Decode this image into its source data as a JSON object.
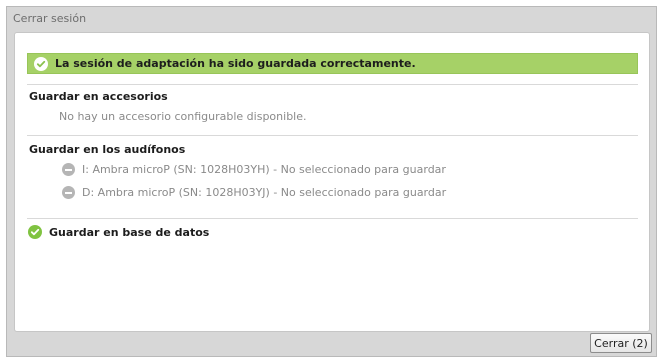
{
  "dialog": {
    "title": "Cerrar sesión",
    "banner": {
      "icon": "check-circle-icon",
      "text": "La sesión de adaptación ha sido guardada correctamente.",
      "color": "#a6d167"
    },
    "accessories": {
      "title": "Guardar en accesorios",
      "message": "No hay un accesorio configurable disponible."
    },
    "hearing_aids": {
      "title": "Guardar en los audífonos",
      "items": [
        {
          "icon": "minus-circle-icon",
          "text": "I: Ambra microP (SN: 1028H03YH) - No seleccionado para guardar"
        },
        {
          "icon": "minus-circle-icon",
          "text": "D: Ambra microP (SN: 1028H03YJ) - No seleccionado para guardar"
        }
      ]
    },
    "database": {
      "icon": "check-circle-icon",
      "title": "Guardar en base de datos",
      "color": "#80c341"
    },
    "close_label": "Cerrar (2)"
  }
}
